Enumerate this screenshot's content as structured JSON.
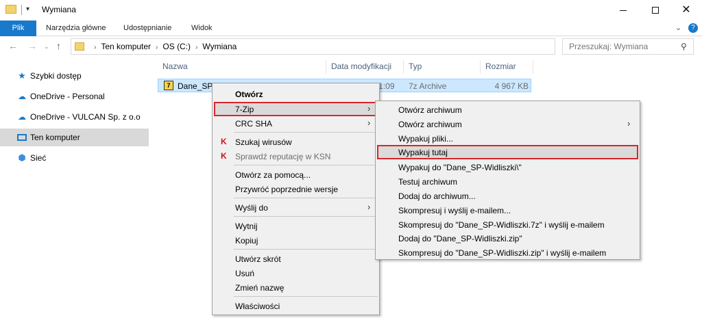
{
  "window": {
    "title": "Wymiana",
    "qa_arrow": "▾",
    "min_label": "",
    "close_glyph": "✕"
  },
  "ribbon": {
    "tabs": [
      "Plik",
      "Narzędzia główne",
      "Udostępnianie",
      "Widok"
    ],
    "chevron": "⌄",
    "help": "?"
  },
  "nav": {
    "back": "←",
    "forward": "→",
    "history": "⌄",
    "up": "↑",
    "crumbs": [
      "Ten komputer",
      "OS (C:)",
      "Wymiana"
    ],
    "crumb_sep": "›",
    "dropdown": "⌄",
    "refresh": "↻"
  },
  "search": {
    "placeholder": "Przeszukaj: Wymiana",
    "icon": "⚲"
  },
  "sidebar": {
    "items": [
      {
        "label": "Szybki dostęp",
        "icon": "★"
      },
      {
        "label": "OneDrive - Personal",
        "icon": "☁"
      },
      {
        "label": "OneDrive - VULCAN Sp. z o.o",
        "icon": "☁"
      },
      {
        "label": "Ten komputer",
        "icon": ""
      },
      {
        "label": "Sieć",
        "icon": "⬢"
      }
    ],
    "selected_index": 3
  },
  "filelist": {
    "columns": [
      "Nazwa",
      "Data modyfikacji",
      "Typ",
      "Rozmiar"
    ],
    "rows": [
      {
        "icon": "7",
        "name": "Dane_SP-Widliszki.7z",
        "date": "13.09.2017 11:09",
        "type": "7z Archive",
        "size": "4 967 KB"
      }
    ]
  },
  "context_menu": {
    "arrow": "›",
    "items": [
      {
        "label": "Otwórz"
      },
      {
        "label": "7-Zip"
      },
      {
        "label": "CRC SHA"
      },
      {
        "label": "Szukaj wirusów",
        "icon": "K"
      },
      {
        "label": "Sprawdź reputację w KSN",
        "icon": "K"
      },
      {
        "label": "Otwórz za pomocą..."
      },
      {
        "label": "Przywróć poprzednie wersje"
      },
      {
        "label": "Wyślij do"
      },
      {
        "label": "Wytnij"
      },
      {
        "label": "Kopiuj"
      },
      {
        "label": "Utwórz skrót"
      },
      {
        "label": "Usuń"
      },
      {
        "label": "Zmień nazwę"
      },
      {
        "label": "Właściwości"
      }
    ]
  },
  "submenu": {
    "arrow": "›",
    "items": [
      {
        "label": "Otwórz archiwum"
      },
      {
        "label": "Otwórz archiwum"
      },
      {
        "label": "Wypakuj pliki..."
      },
      {
        "label": "Wypakuj tutaj"
      },
      {
        "label": "Wypakuj do \"Dane_SP-Widliszki\\\""
      },
      {
        "label": "Testuj archiwum"
      },
      {
        "label": "Dodaj do archiwum..."
      },
      {
        "label": "Skompresuj i wyślij e-mailem..."
      },
      {
        "label": "Skompresuj do \"Dane_SP-Widliszki.7z\" i wyślij e-mailem"
      },
      {
        "label": "Dodaj do \"Dane_SP-Widliszki.zip\""
      },
      {
        "label": "Skompresuj do \"Dane_SP-Widliszki.zip\" i wyślij e-mailem"
      }
    ]
  },
  "colors": {
    "accent": "#1979ca",
    "highlight_border": "#d6262b",
    "selection": "#cce8ff"
  }
}
